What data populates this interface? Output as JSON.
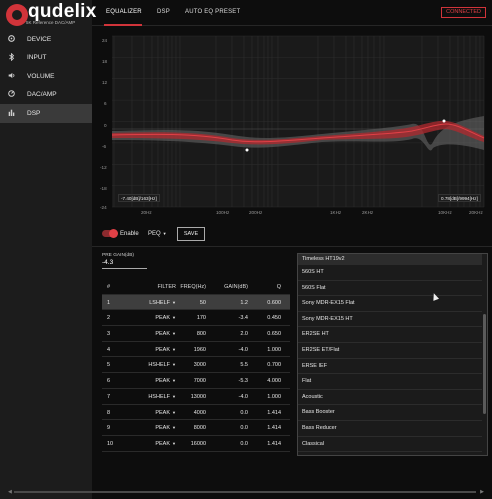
{
  "brand": {
    "name": "qudelix",
    "subtitle": "5K Reference DAC/AMP"
  },
  "sidebar": {
    "items": [
      {
        "label": "DEVICE",
        "icon": "device-icon"
      },
      {
        "label": "INPUT",
        "icon": "bluetooth-icon"
      },
      {
        "label": "VOLUME",
        "icon": "volume-icon"
      },
      {
        "label": "DAC/AMP",
        "icon": "dac-amp-icon"
      },
      {
        "label": "DSP",
        "icon": "bars-icon",
        "active": true
      }
    ]
  },
  "tabs": [
    {
      "label": "EQUALIZER",
      "active": true
    },
    {
      "label": "DSP"
    },
    {
      "label": "AUTO EQ PRESET"
    }
  ],
  "status": "CONNECTED",
  "graph": {
    "y_ticks": [
      "24",
      "18",
      "12",
      "6",
      "0",
      "-6",
      "-12",
      "-18",
      "-24"
    ],
    "x_ticks": [
      "20Hz",
      "100Hz",
      "200Hz",
      "1KHz",
      "2KHz",
      "10KHz",
      "20KHz"
    ],
    "readout_left": "-7.40[dB]/163[Hz]",
    "readout_right": "0.78[dB]/9994[Hz]",
    "accent": "#d1343a"
  },
  "controls": {
    "enable_label": "Enable",
    "mode": "PEQ",
    "save_label": "SAVE"
  },
  "pregain": {
    "label": "PRE GAIN(dB)",
    "value": "-4.3"
  },
  "table": {
    "headers": [
      "#",
      "FILTER",
      "FREQ(Hz)",
      "GAIN(dB)",
      "Q"
    ],
    "rows": [
      {
        "idx": "1",
        "filter": "LSHELF",
        "freq": "50",
        "gain": "1.2",
        "q": "0.600",
        "selected": true
      },
      {
        "idx": "2",
        "filter": "PEAK",
        "freq": "170",
        "gain": "-3.4",
        "q": "0.450"
      },
      {
        "idx": "3",
        "filter": "PEAK",
        "freq": "800",
        "gain": "2.0",
        "q": "0.650"
      },
      {
        "idx": "4",
        "filter": "PEAK",
        "freq": "1960",
        "gain": "-4.0",
        "q": "1.000"
      },
      {
        "idx": "5",
        "filter": "HSHELF",
        "freq": "3000",
        "gain": "5.5",
        "q": "0.700"
      },
      {
        "idx": "6",
        "filter": "PEAK",
        "freq": "7000",
        "gain": "-5.3",
        "q": "4.000"
      },
      {
        "idx": "7",
        "filter": "HSHELF",
        "freq": "13000",
        "gain": "-4.0",
        "q": "1.000"
      },
      {
        "idx": "8",
        "filter": "PEAK",
        "freq": "4000",
        "gain": "0.0",
        "q": "1.414"
      },
      {
        "idx": "9",
        "filter": "PEAK",
        "freq": "8000",
        "gain": "0.0",
        "q": "1.414"
      },
      {
        "idx": "10",
        "filter": "PEAK",
        "freq": "16000",
        "gain": "0.0",
        "q": "1.414"
      }
    ]
  },
  "presets": [
    "Timeless HT19v2",
    "560S HT",
    "560S Flat",
    "Sony MDR-EX15 Flat",
    "Sony MDR-EX15 HT",
    "ER2SE HT",
    "ER2SE ET/Flat",
    "ERSE IEF",
    "Flat",
    "Acoustic",
    "Bass Booster",
    "Bass Reducer",
    "Classical"
  ]
}
